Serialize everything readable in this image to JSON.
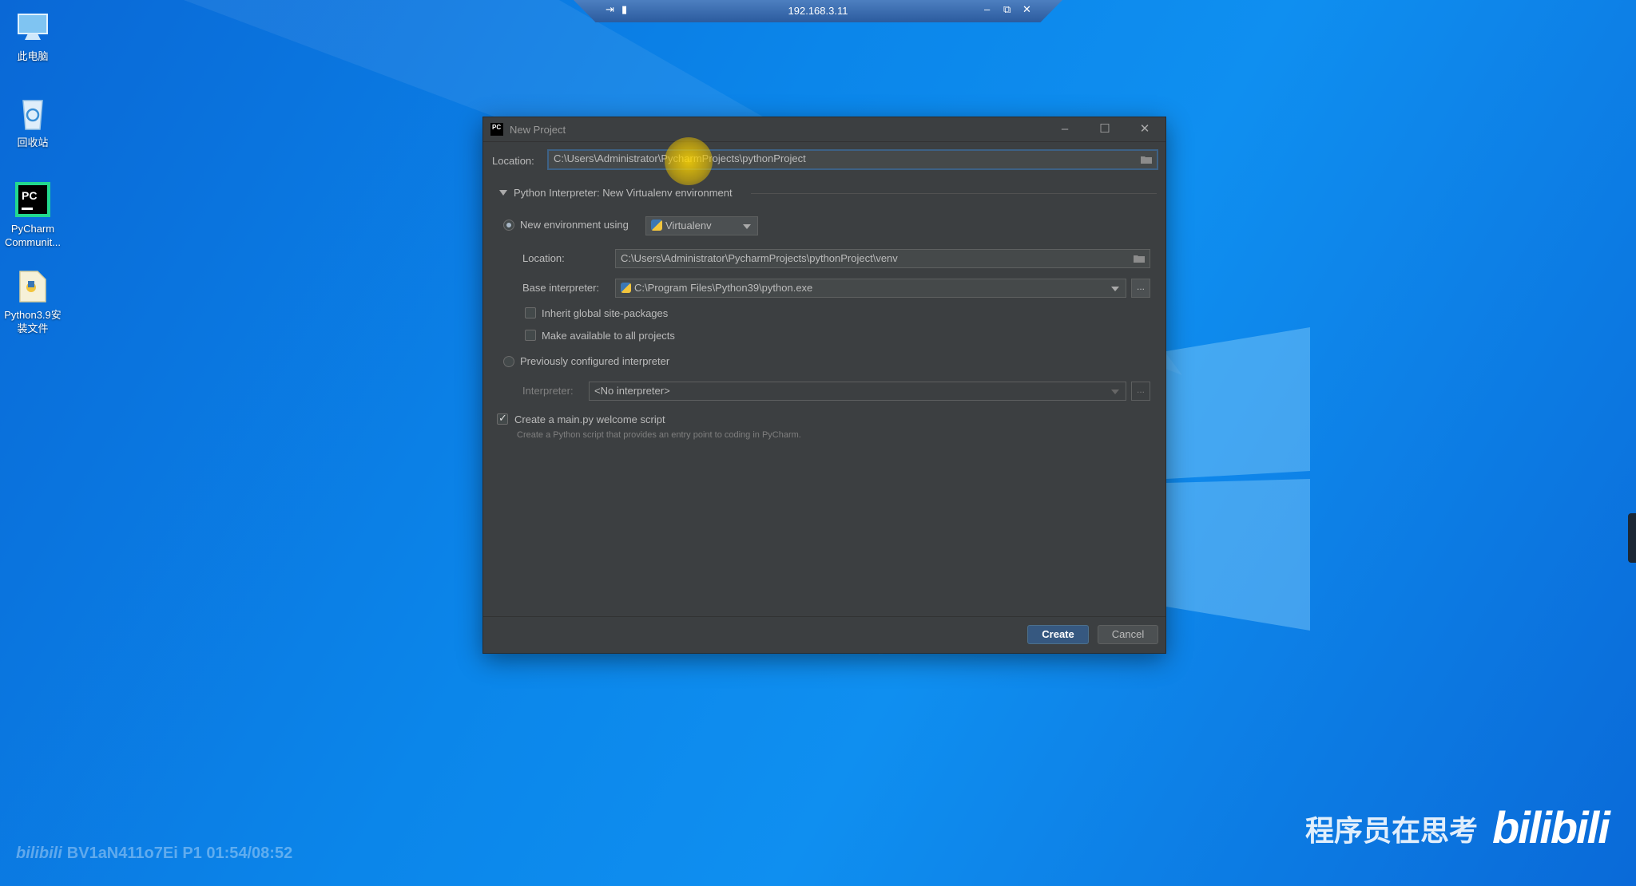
{
  "desktop": {
    "icons": [
      {
        "label": "此电脑"
      },
      {
        "label": "回收站"
      },
      {
        "label": "PyCharm Communit..."
      },
      {
        "label": "Python3.9安装文件"
      }
    ]
  },
  "remote_bar": {
    "ip": "192.168.3.11"
  },
  "dialog": {
    "title": "New Project",
    "location_label": "Location:",
    "location_value": "C:\\Users\\Administrator\\PycharmProjects\\pythonProject",
    "interpreter_section": "Python Interpreter: New Virtualenv environment",
    "new_env_label": "New environment using",
    "env_tool": "Virtualenv",
    "venv_location_label": "Location:",
    "venv_location_value": "C:\\Users\\Administrator\\PycharmProjects\\pythonProject\\venv",
    "base_interp_label": "Base interpreter:",
    "base_interp_value": "C:\\Program Files\\Python39\\python.exe",
    "inherit_label": "Inherit global site-packages",
    "make_available_label": "Make available to all projects",
    "prev_configured_label": "Previously configured interpreter",
    "interpreter_label": "Interpreter:",
    "interpreter_value": "<No interpreter>",
    "dots": "...",
    "welcome_label": "Create a main.py welcome script",
    "welcome_desc": "Create a Python script that provides an entry point to coding in PyCharm.",
    "create_label": "Create",
    "cancel_label": "Cancel",
    "states": {
      "new_env_selected": true,
      "prev_selected": false,
      "inherit_checked": false,
      "make_available_checked": false,
      "welcome_checked": true
    }
  },
  "watermark": {
    "left": "BV1aN411o7Ei P1 01:54/08:52",
    "right": "程序员在思考",
    "brand": "bilibili"
  }
}
